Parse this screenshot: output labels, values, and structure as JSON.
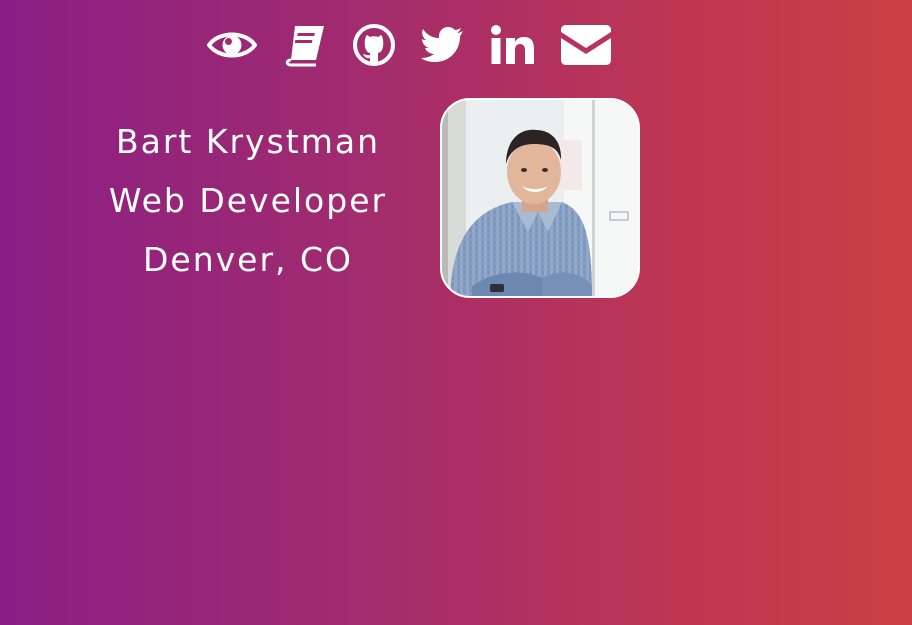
{
  "nav": {
    "icons": [
      {
        "name": "eye-icon",
        "label": "Portfolio"
      },
      {
        "name": "book-icon",
        "label": "Blog"
      },
      {
        "name": "github-icon",
        "label": "GitHub"
      },
      {
        "name": "twitter-icon",
        "label": "Twitter"
      },
      {
        "name": "linkedin-icon",
        "label": "LinkedIn"
      },
      {
        "name": "envelope-icon",
        "label": "Email"
      }
    ]
  },
  "profile": {
    "name": "Bart Krystman",
    "title": "Web Developer",
    "location": "Denver, CO",
    "photo_alt": "Bart Krystman"
  },
  "colors": {
    "gradient_start": "#8a1e86",
    "gradient_end": "#cc3f43",
    "foreground": "#ffffff"
  }
}
